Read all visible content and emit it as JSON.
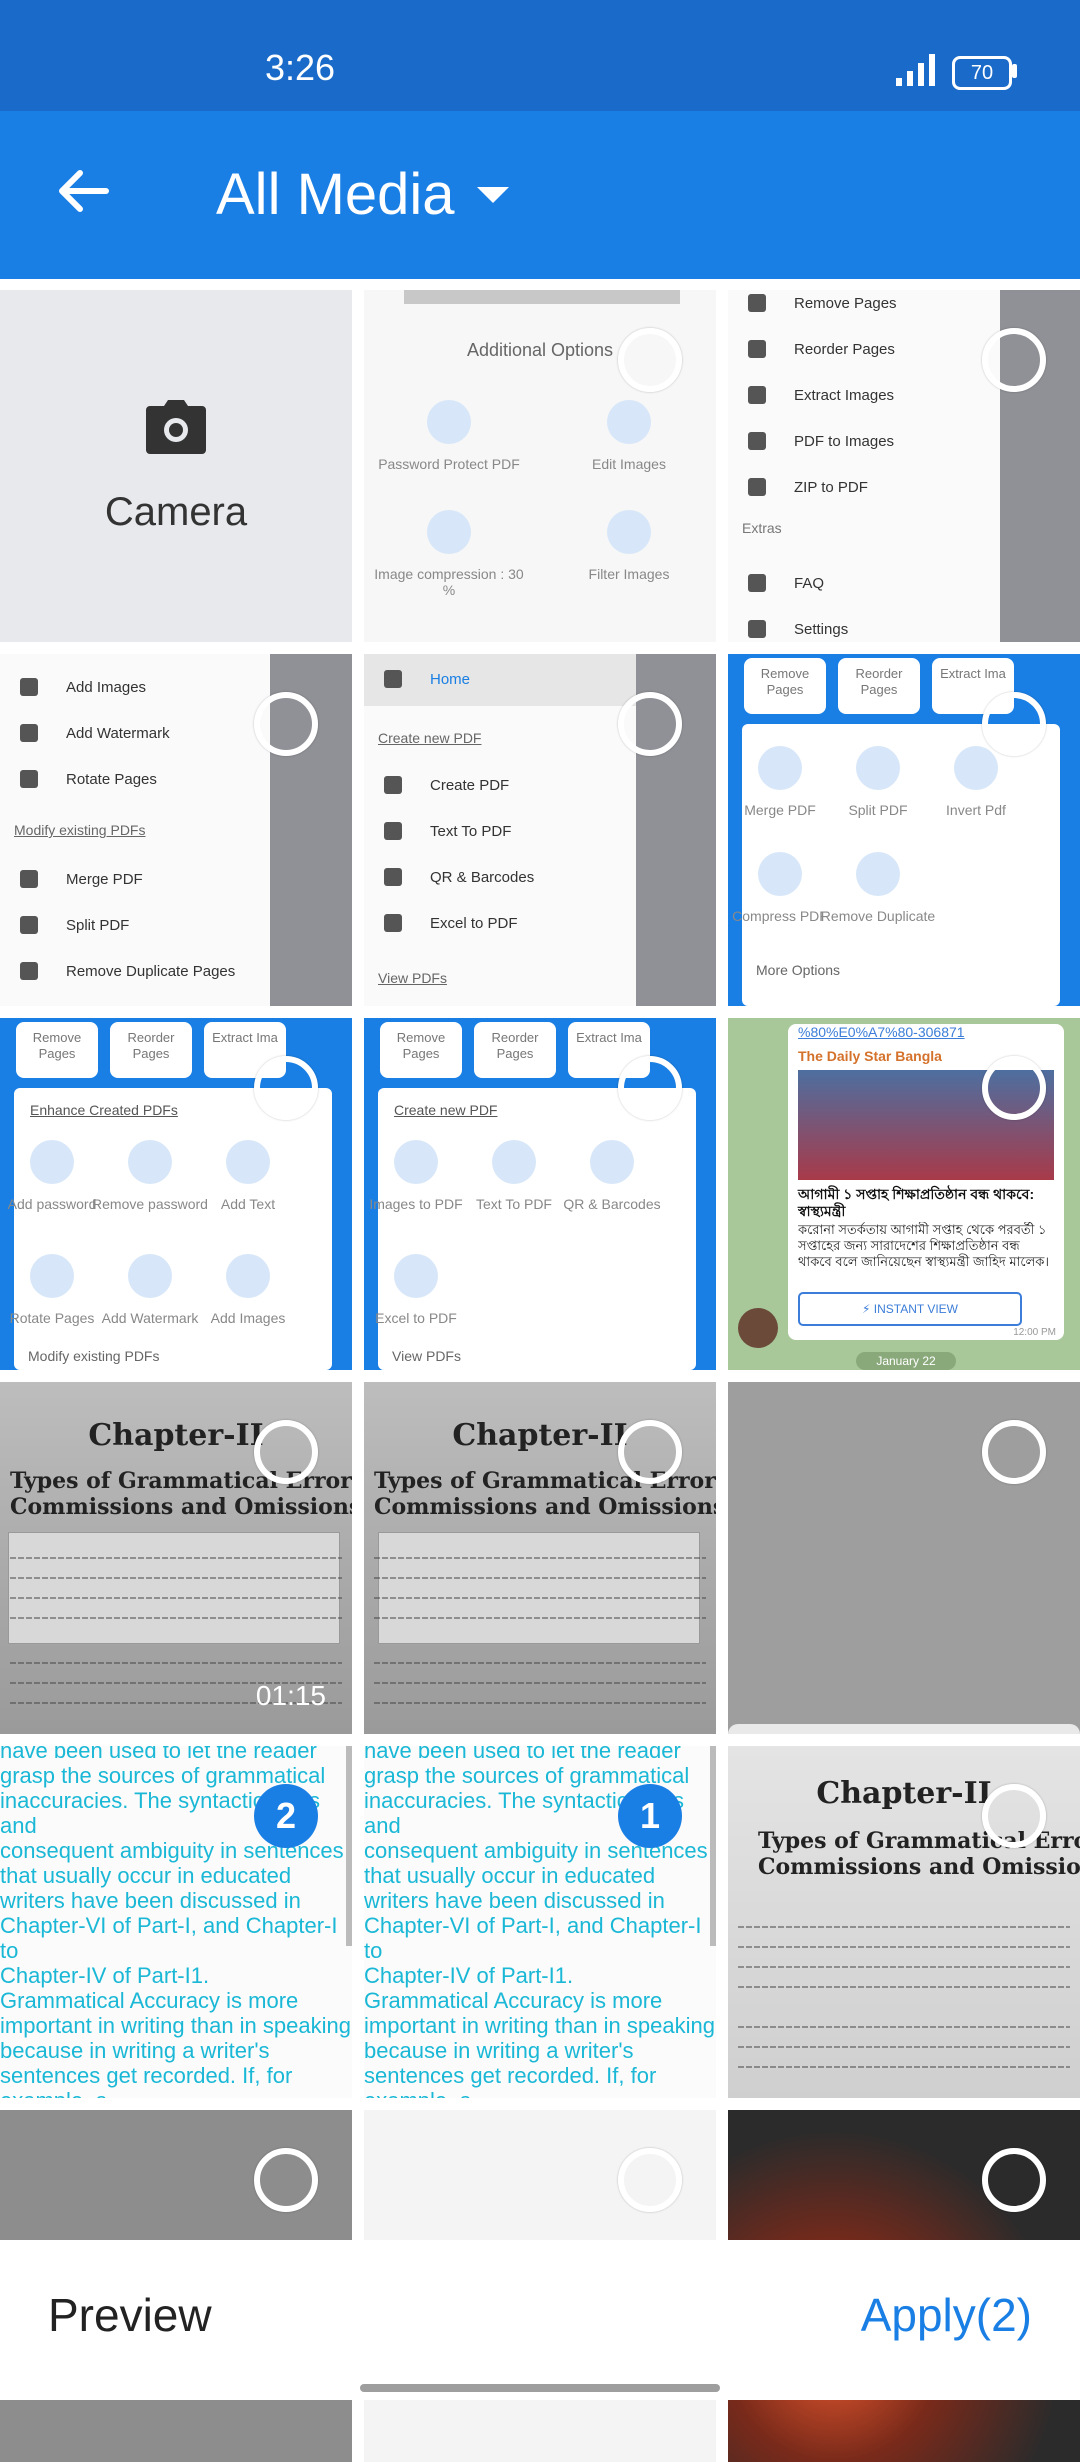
{
  "status_bar": {
    "time": "3:26",
    "battery": "70"
  },
  "app_bar": {
    "title": "All Media"
  },
  "camera_tile": {
    "label": "Camera"
  },
  "tiles": {
    "t1": {
      "heading": "Additional Options",
      "options": [
        "Password Protect PDF",
        "Edit Images",
        "Image compression : 30 %",
        "Filter Images"
      ]
    },
    "t2": {
      "items": [
        "Remove Pages",
        "Reorder Pages",
        "Extract Images",
        "PDF to Images",
        "ZIP to PDF"
      ],
      "section": "Extras",
      "extras": [
        "FAQ",
        "Settings"
      ]
    },
    "t3": {
      "items": [
        "Add Images",
        "Add Watermark",
        "Rotate Pages"
      ],
      "section": "Modify existing PDFs",
      "items2": [
        "Merge PDF",
        "Split PDF",
        "Remove Duplicate Pages"
      ]
    },
    "t4": {
      "home": "Home",
      "section": "Create new PDF",
      "items": [
        "Create PDF",
        "Text To PDF",
        "QR & Barcodes",
        "Excel to PDF"
      ],
      "footer": "View PDFs"
    },
    "t5": {
      "tabs": [
        "Remove Pages",
        "Reorder Pages",
        "Extract Ima"
      ],
      "options": [
        "Merge PDF",
        "Split PDF",
        "Invert Pdf",
        "Compress PDF",
        "Remove Duplicate"
      ],
      "footer": "More Options"
    },
    "t6": {
      "tabs": [
        "Remove Pages",
        "Reorder Pages",
        "Extract Ima"
      ],
      "title": "Enhance Created PDFs",
      "options": [
        "Add password",
        "Remove password",
        "Add Text",
        "Rotate Pages",
        "Add Watermark",
        "Add Images"
      ],
      "footer": "Modify existing PDFs"
    },
    "t7": {
      "tabs": [
        "Remove Pages",
        "Reorder Pages",
        "Extract Ima"
      ],
      "title": "Create new PDF",
      "options": [
        "Images to PDF",
        "Text To PDF",
        "QR & Barcodes",
        "Excel to PDF"
      ],
      "footer": "View PDFs"
    },
    "t8": {
      "link": "%80%E0%A7%80-306871",
      "source": "The Daily Star Bangla",
      "headline": "আগামী ১ সপ্তাহ শিক্ষাপ্রতিষ্ঠান বন্ধ থাকবে: স্বাস্থ্যমন্ত্রী",
      "body": "করোনা সতর্কতায় আগামী সপ্তাহ থেকে পরবর্তী ১ সপ্তাহের জন্য সারাদেশের শিক্ষাপ্রতিষ্ঠান বন্ধ থাকবে বলে জানিয়েছেন স্বাস্থ্যমন্ত্রী জাহিদ মালেক।",
      "button": "⚡ INSTANT VIEW",
      "time": "12:00 PM",
      "date": "January 22"
    },
    "t9": {
      "title": "Chapter-II",
      "subtitle": "Types of Grammatical Error Commissions and Omissions",
      "duration": "01:15"
    },
    "t10": {
      "title": "Chapter-II",
      "subtitle": "Types of Grammatical Error Commissions and Omissions"
    },
    "t12": {
      "text": "have been used to let the reader\ngrasp the sources of grammatical\ninaccuracies. The syntactic flaws\nand\nconsequent ambiguity in sentences\nthat usually occur in educated\nwriters have been discussed in\nChapter-VI of Part-I, and Chapter-I to\nChapter-IV of Part-I1.\nGrammatical Accuracy is more\nimportant in writing than in speaking\nbecause in writing a writer's\nsentences get recorded. If, for\nexample, a\nsophisticated reader discovers",
      "badge": "2"
    },
    "t13": {
      "text": "have been used to let the reader\ngrasp the sources of grammatical\ninaccuracies. The syntactic flaws\nand\nconsequent ambiguity in sentences\nthat usually occur in educated\nwriters have been discussed in\nChapter-VI of Part-I, and Chapter-I to\nChapter-IV of Part-I1.\nGrammatical Accuracy is more\nimportant in writing than in speaking\nbecause in writing a writer's\nsentences get recorded. If, for\nexample, a\nsophisticated reader discovers",
      "badge": "1"
    },
    "t14": {
      "title": "Chapter-II",
      "subtitle": "Types of Grammatical Error Commissions and Omissions"
    }
  },
  "bottom_bar": {
    "preview": "Preview",
    "apply": "Apply(2)"
  },
  "colors": {
    "primary": "#1a7fe4",
    "status_bar": "#1a6bc9",
    "text_cyan": "#1ab8d6"
  }
}
